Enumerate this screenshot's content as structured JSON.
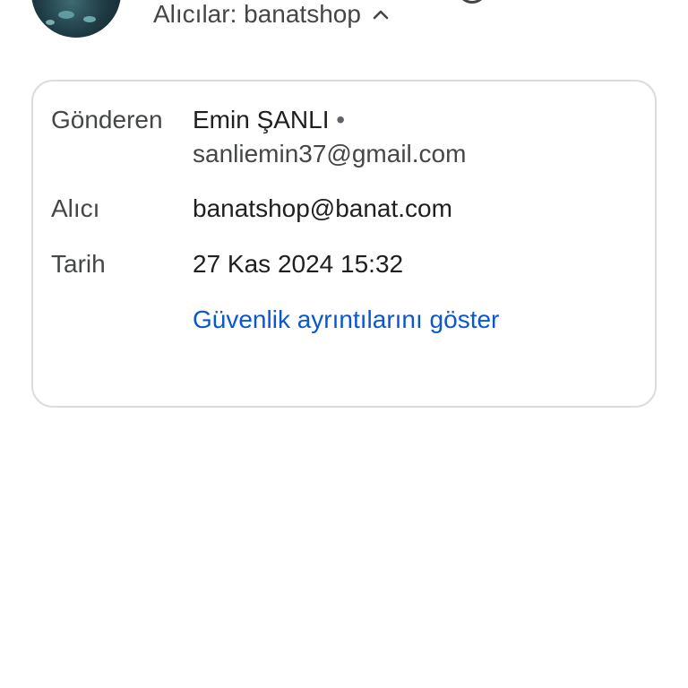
{
  "header": {
    "recipients_text": "Alıcılar: banatshop",
    "expand_icon": "chevron-up-icon"
  },
  "details": {
    "from_label": "Gönderen",
    "from_name": "Emin ŞANLI",
    "from_separator": "•",
    "from_email": "sanliemin37@gmail.com",
    "to_label": "Alıcı",
    "to_value": "banatshop@banat.com",
    "date_label": "Tarih",
    "date_value": "27 Kas 2024 15:32",
    "security_link": "Güvenlik ayrıntılarını göster"
  },
  "colors": {
    "link": "#0b57d0",
    "label": "#444746",
    "value": "#1f1f1f",
    "card_border": "#dadce0"
  }
}
